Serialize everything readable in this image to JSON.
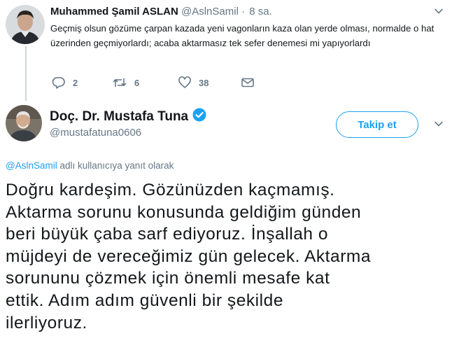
{
  "reply_tweet": {
    "author_name": "Muhammed Şamil ASLAN",
    "author_handle": "@AslnSamil",
    "separator": "·",
    "time": "8 sa.",
    "text": "Geçmiş olsun gözüme çarpan kazada yeni vagonların kaza olan yerde olması, normalde o hat üzerinden geçmiyorlardı; acaba aktarmasız tek sefer denemesi mi yapıyorlardı",
    "actions": {
      "replies": "2",
      "retweets": "6",
      "likes": "38"
    }
  },
  "main_tweet": {
    "author_name": "Doç. Dr. Mustafa Tuna",
    "author_handle": "@mustafatuna0606",
    "follow_label": "Takip et",
    "reply_context": {
      "mention": "@AslnSamil",
      "rest": "adlı kullanıcıya yanıt olarak"
    },
    "text_lines": [
      "Doğru kardeşim. Gözünüzden kaçmamış.",
      "Aktarma sorunu konusunda geldiğim günden",
      "beri büyük çaba sarf ediyoruz. İnşallah o",
      "müjdeyi de vereceğimiz gün gelecek. Aktarma",
      "sorununu çözmek için önemli mesafe kat",
      "ettik. Adım adım güvenli bir şekilde",
      "ilerliyoruz."
    ]
  },
  "colors": {
    "accent": "#1da1f2",
    "secondary_text": "#657786",
    "primary_text": "#14171a"
  },
  "icons": [
    "reply-icon",
    "retweet-icon",
    "like-icon",
    "direct-message-icon",
    "chevron-down-icon",
    "verified-badge-icon"
  ]
}
